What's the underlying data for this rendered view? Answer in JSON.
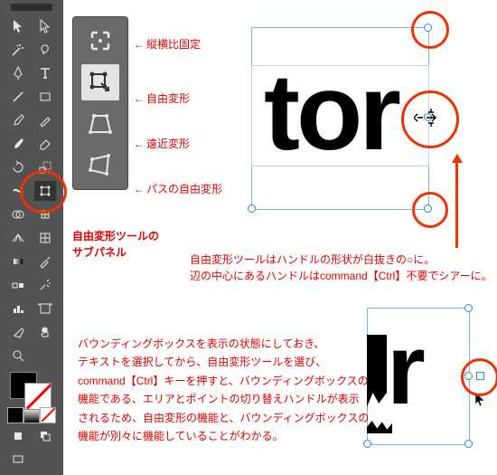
{
  "annotations": {
    "lock_aspect": "縦横比固定",
    "free_transform": "自由変形",
    "perspective": "遠近変形",
    "free_path": "パスの自由変形",
    "subpanel_title_1": "自由変形ツールの",
    "subpanel_title_2": "サブパネル"
  },
  "mid_note": {
    "line1": "自由変形ツールはハンドルの形状が白抜きの○に。",
    "line2": "辺の中心にあるハンドルはcommand【Ctrl】不要でシアーに。"
  },
  "bottom_note": {
    "l1": "バウンディングボックスを表示の状態にしておき、",
    "l2": "テキストを選択してから、自由変形ツールを選び、",
    "l3": "command【Ctrl】キーを押すと、バウンディングボックスの",
    "l4": "機能である、エリアとポイントの切り替えハンドルが表示",
    "l5": "されるため、自由変形の機能と、バウンディングボックスの",
    "l6": "機能が別々に機能していることがわかる。"
  },
  "sample_text": "tor",
  "sample_text2": "r",
  "icons": {
    "selection": "selection-icon",
    "direct": "direct-selection-icon",
    "wand": "wand-icon",
    "lasso": "lasso-icon",
    "pen": "pen-icon",
    "type": "type-icon",
    "line": "line-icon",
    "rect": "rect-icon",
    "brush": "brush-icon",
    "pencil": "pencil-icon",
    "eraser": "eraser-icon",
    "rotate": "rotate-icon",
    "scale": "scale-icon",
    "width": "width-tool-icon",
    "free_transform": "free-transform-icon",
    "shape_builder": "shape-builder-icon",
    "perspective_grid": "perspective-grid-icon",
    "mesh": "mesh-icon",
    "gradient": "gradient-icon",
    "eyedropper": "eyedropper-icon",
    "blend": "blend-icon",
    "symbol": "symbol-icon",
    "graph": "graph-icon",
    "artboard": "artboard-icon",
    "slice": "slice-icon",
    "hand": "hand-icon",
    "zoom": "zoom-icon"
  }
}
